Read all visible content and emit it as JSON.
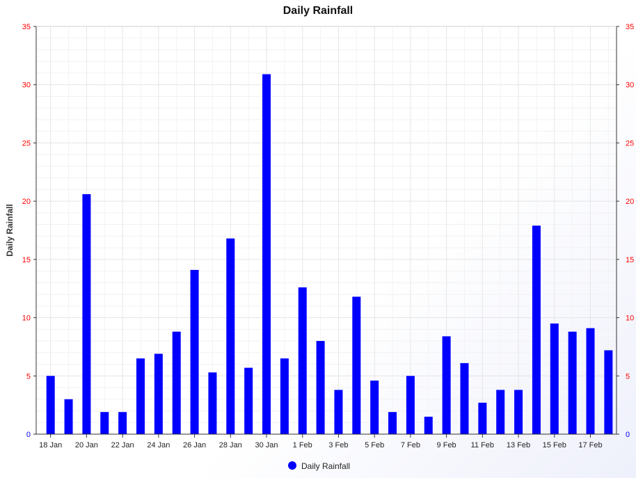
{
  "chart_data": {
    "type": "bar",
    "title": "Daily Rainfall",
    "ylabel": "Daily Rainfall",
    "xlabel": "",
    "ylim": [
      0,
      35
    ],
    "y_ticks": [
      0,
      5,
      10,
      15,
      20,
      25,
      30,
      35
    ],
    "grid": true,
    "legend": "bottom-center",
    "axes": "left-and-right",
    "colors": {
      "bar": "#0000ff",
      "tick_text": "#ff0000",
      "zero_tick": "#0000ff",
      "grid": "#e6e6e6"
    },
    "x_tick_labels": [
      "18 Jan",
      "20 Jan",
      "22 Jan",
      "24 Jan",
      "26 Jan",
      "28 Jan",
      "30 Jan",
      "1 Feb",
      "3 Feb",
      "5 Feb",
      "7 Feb",
      "9 Feb",
      "11 Feb",
      "13 Feb",
      "15 Feb",
      "17 Feb"
    ],
    "categories": [
      "18 Jan",
      "19 Jan",
      "20 Jan",
      "21 Jan",
      "22 Jan",
      "23 Jan",
      "24 Jan",
      "25 Jan",
      "26 Jan",
      "27 Jan",
      "28 Jan",
      "29 Jan",
      "30 Jan",
      "31 Jan",
      "1 Feb",
      "2 Feb",
      "3 Feb",
      "4 Feb",
      "5 Feb",
      "6 Feb",
      "7 Feb",
      "8 Feb",
      "9 Feb",
      "10 Feb",
      "11 Feb",
      "12 Feb",
      "13 Feb",
      "14 Feb",
      "15 Feb",
      "16 Feb",
      "17 Feb",
      "18 Feb"
    ],
    "series": [
      {
        "name": "Daily Rainfall",
        "values": [
          5,
          3,
          20.6,
          1.9,
          1.9,
          6.5,
          6.9,
          8.8,
          14.1,
          5.3,
          16.8,
          5.7,
          30.9,
          6.5,
          12.6,
          8,
          3.8,
          11.8,
          4.6,
          1.9,
          5,
          1.5,
          8.4,
          6.1,
          2.7,
          3.8,
          3.8,
          17.9,
          9.5,
          8.8,
          9.1,
          7.2
        ]
      }
    ]
  }
}
